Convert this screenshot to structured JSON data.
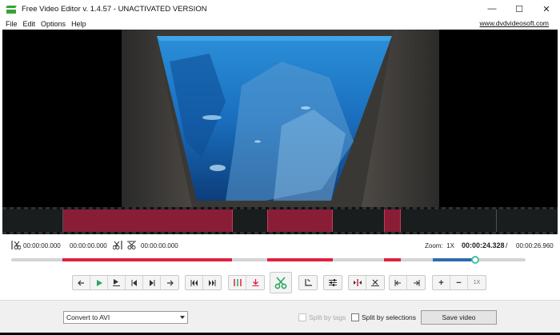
{
  "window": {
    "title": "Free Video Editor v. 1.4.57 - UNACTIVATED VERSION",
    "minimize": "—",
    "maximize": "☐",
    "close": "✕"
  },
  "menu": {
    "items": [
      "File",
      "Edit",
      "Options",
      "Help"
    ],
    "site_link": "www.dvdvideosoft.com"
  },
  "times": {
    "cut_start": "00:00:00.000",
    "cut_end": "00:00:00.000",
    "cut_mark": "00:00:00.000",
    "zoom_label": "Zoom:",
    "zoom_value": "1X",
    "current": "00:00:24.328",
    "separator": "/",
    "total": "00:00:26.960"
  },
  "playback": {
    "position_fraction": 0.902
  },
  "controls": {
    "speed_label": "1X",
    "plus": "+",
    "minus": "−"
  },
  "bottom": {
    "format_value": "Convert to AVI",
    "split_by_tags": "Split by tags",
    "split_by_selections": "Split by selections",
    "save_label": "Save video"
  },
  "colors": {
    "selection": "#8a1d36",
    "track_red": "#e0203e",
    "track_blue": "#2f6bb0",
    "knob_ring": "#45c1a4",
    "app_icon": "#3aa334"
  }
}
